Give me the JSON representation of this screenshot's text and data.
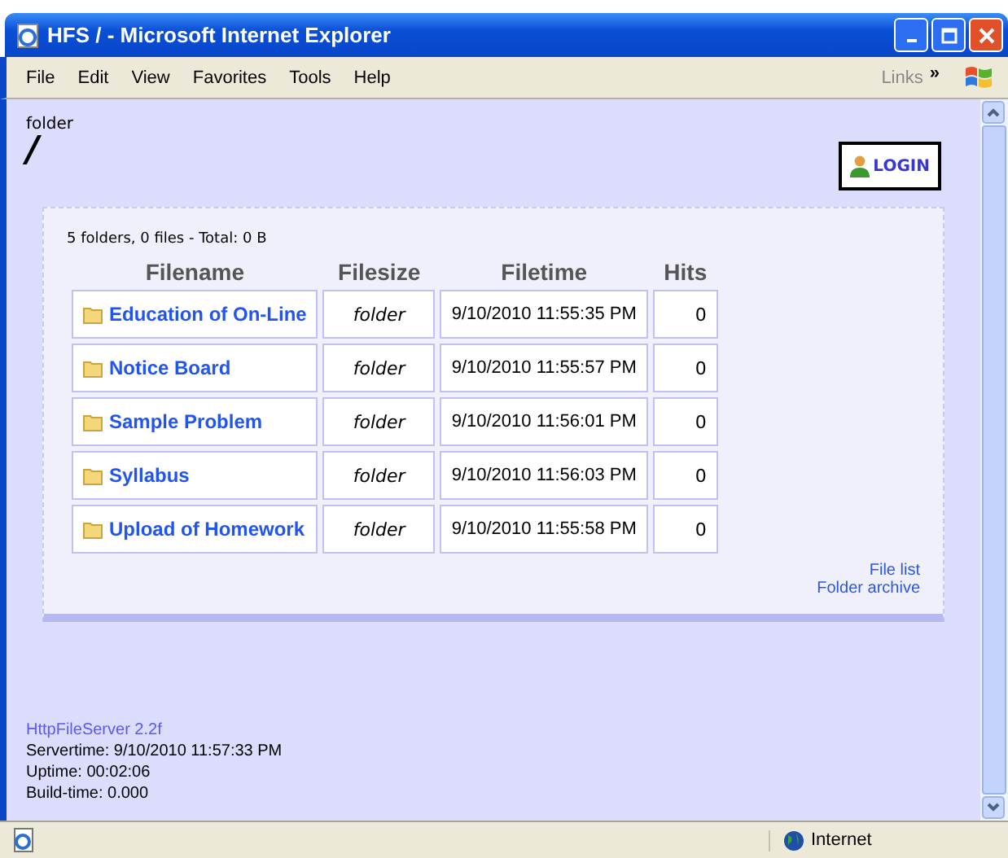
{
  "window": {
    "title": "HFS / - Microsoft Internet Explorer"
  },
  "menu": [
    "File",
    "Edit",
    "View",
    "Favorites",
    "Tools",
    "Help"
  ],
  "links_label": "Links",
  "links_more": "»",
  "page": {
    "caption": "folder",
    "path": "/",
    "login": "LOGIN",
    "summary": "5 folders, 0 files - Total: 0 B"
  },
  "table": {
    "columns": [
      "Filename",
      "Filesize",
      "Filetime",
      "Hits"
    ],
    "rows": [
      {
        "name": "Education of On-Line",
        "size": "folder",
        "time": "9/10/2010 11:55:35 PM",
        "hits": "0"
      },
      {
        "name": "Notice Board",
        "size": "folder",
        "time": "9/10/2010 11:55:57 PM",
        "hits": "0"
      },
      {
        "name": "Sample Problem",
        "size": "folder",
        "time": "9/10/2010 11:56:01 PM",
        "hits": "0"
      },
      {
        "name": "Syllabus",
        "size": "folder",
        "time": "9/10/2010 11:56:03 PM",
        "hits": "0"
      },
      {
        "name": "Upload of Homework",
        "size": "folder",
        "time": "9/10/2010 11:55:58 PM",
        "hits": "0"
      }
    ]
  },
  "side_links": [
    "File list",
    "Folder archive"
  ],
  "footer": {
    "server": "HttpFileServer 2.2f",
    "lines": [
      "Servertime: 9/10/2010 11:57:33 PM",
      "Uptime: 00:02:06",
      "Build-time: 0.000"
    ]
  },
  "status_bar": {
    "zone": "Internet"
  }
}
